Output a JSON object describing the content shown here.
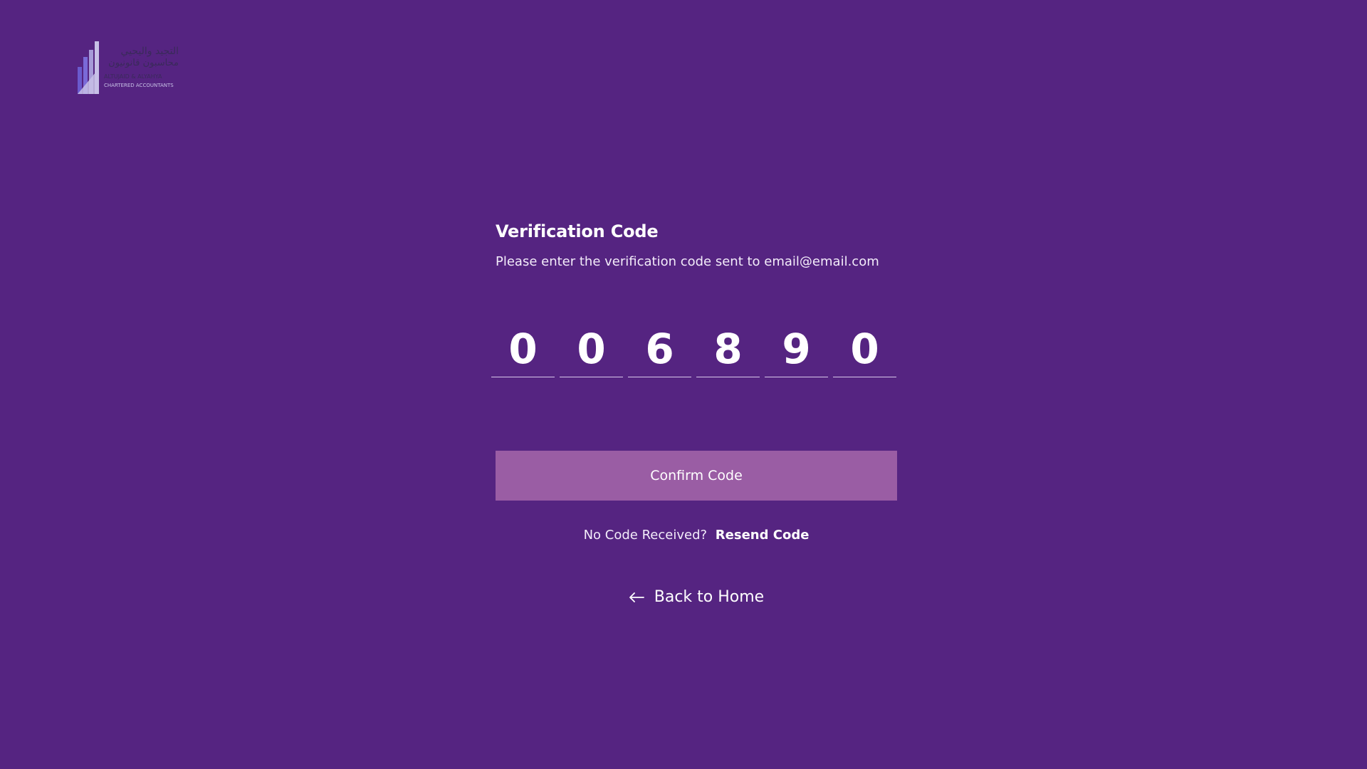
{
  "brand": {
    "logo_arabic_line1": "التجيد واليحيي",
    "logo_arabic_line2": "محاسبون قانونيون",
    "logo_english_line1": "ALTUJAID & ALYAHYA",
    "logo_english_line2": "CHARTERED ACCOUNTANTS",
    "logo_colors": [
      "#6a5acd",
      "#a79bd8",
      "#c7c0e6"
    ]
  },
  "verification": {
    "title": "Verification Code",
    "subtitle": "Please enter the verification code sent to email@email.com",
    "digits": [
      "0",
      "0",
      "6",
      "8",
      "9",
      "0"
    ],
    "confirm_label": "Confirm Code",
    "no_code_text": "No Code Received?",
    "resend_label": "Resend Code",
    "back_label": "Back to Home",
    "back_icon": "arrow-left-icon"
  },
  "colors": {
    "background": "#552481",
    "button": "#9a5da4",
    "text": "#ffffff"
  }
}
